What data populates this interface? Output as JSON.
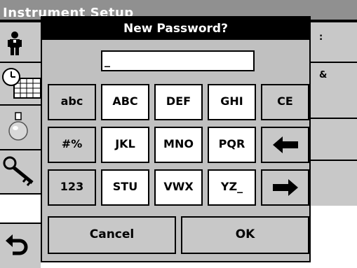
{
  "background": {
    "title": "Instrument Setup",
    "right_labels": [
      ":",
      "&"
    ],
    "icons": [
      "operator-icon",
      "clock-calendar-icon",
      "flask-icon",
      "key-icon",
      "back-arrow-icon"
    ]
  },
  "dialog": {
    "title": "New Password?",
    "input_value": "_",
    "keys": {
      "abc": "abc",
      "ABC": "ABC",
      "DEF": "DEF",
      "GHI": "GHI",
      "CE": "CE",
      "symbols": "#%",
      "JKL": "JKL",
      "MNO": "MNO",
      "PQR": "PQR",
      "left_arrow": "arrow-left-icon",
      "num": "123",
      "STU": "STU",
      "VWX": "VWX",
      "YZ": "YZ_",
      "right_arrow": "arrow-right-icon"
    },
    "cancel_label": "Cancel",
    "ok_label": "OK"
  },
  "colors": {
    "title_bar": "#909090",
    "dialog_bg": "#c0c0c0",
    "dialog_title_bg": "#000000"
  }
}
